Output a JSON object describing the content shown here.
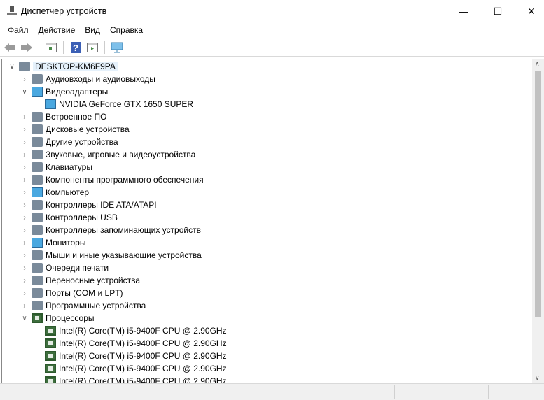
{
  "window": {
    "title": "Диспетчер устройств",
    "minimize": "—",
    "maximize": "☐",
    "close": "✕"
  },
  "menu": [
    "Файл",
    "Действие",
    "Вид",
    "Справка"
  ],
  "tree": {
    "root": "DESKTOP-KM6F9PA",
    "items": [
      {
        "label": "Аудиовходы и аудиовыходы",
        "expanded": false,
        "icon": "speaker-icon"
      },
      {
        "label": "Видеоадаптеры",
        "expanded": true,
        "icon": "display-adapter-icon",
        "children": [
          "NVIDIA GeForce GTX 1650 SUPER"
        ]
      },
      {
        "label": "Встроенное ПО",
        "expanded": false,
        "icon": "firmware-icon"
      },
      {
        "label": "Дисковые устройства",
        "expanded": false,
        "icon": "disk-icon"
      },
      {
        "label": "Другие устройства",
        "expanded": false,
        "icon": "unknown-device-icon"
      },
      {
        "label": "Звуковые, игровые и видеоустройства",
        "expanded": false,
        "icon": "sound-icon"
      },
      {
        "label": "Клавиатуры",
        "expanded": false,
        "icon": "keyboard-icon"
      },
      {
        "label": "Компоненты программного обеспечения",
        "expanded": false,
        "icon": "software-component-icon"
      },
      {
        "label": "Компьютер",
        "expanded": false,
        "icon": "computer-icon"
      },
      {
        "label": "Контроллеры IDE ATA/ATAPI",
        "expanded": false,
        "icon": "ide-controller-icon"
      },
      {
        "label": "Контроллеры USB",
        "expanded": false,
        "icon": "usb-icon"
      },
      {
        "label": "Контроллеры запоминающих устройств",
        "expanded": false,
        "icon": "storage-controller-icon"
      },
      {
        "label": "Мониторы",
        "expanded": false,
        "icon": "monitor-icon"
      },
      {
        "label": "Мыши и иные указывающие устройства",
        "expanded": false,
        "icon": "mouse-icon"
      },
      {
        "label": "Очереди печати",
        "expanded": false,
        "icon": "printer-icon"
      },
      {
        "label": "Переносные устройства",
        "expanded": false,
        "icon": "portable-device-icon"
      },
      {
        "label": "Порты (COM и LPT)",
        "expanded": false,
        "icon": "port-icon"
      },
      {
        "label": "Программные устройства",
        "expanded": false,
        "icon": "software-device-icon"
      },
      {
        "label": "Процессоры",
        "expanded": true,
        "icon": "cpu-icon",
        "children": [
          "Intel(R) Core(TM) i5-9400F CPU @ 2.90GHz",
          "Intel(R) Core(TM) i5-9400F CPU @ 2.90GHz",
          "Intel(R) Core(TM) i5-9400F CPU @ 2.90GHz",
          "Intel(R) Core(TM) i5-9400F CPU @ 2.90GHz",
          "Intel(R) Core(TM) i5-9400F CPU @ 2.90GHz"
        ]
      }
    ]
  }
}
